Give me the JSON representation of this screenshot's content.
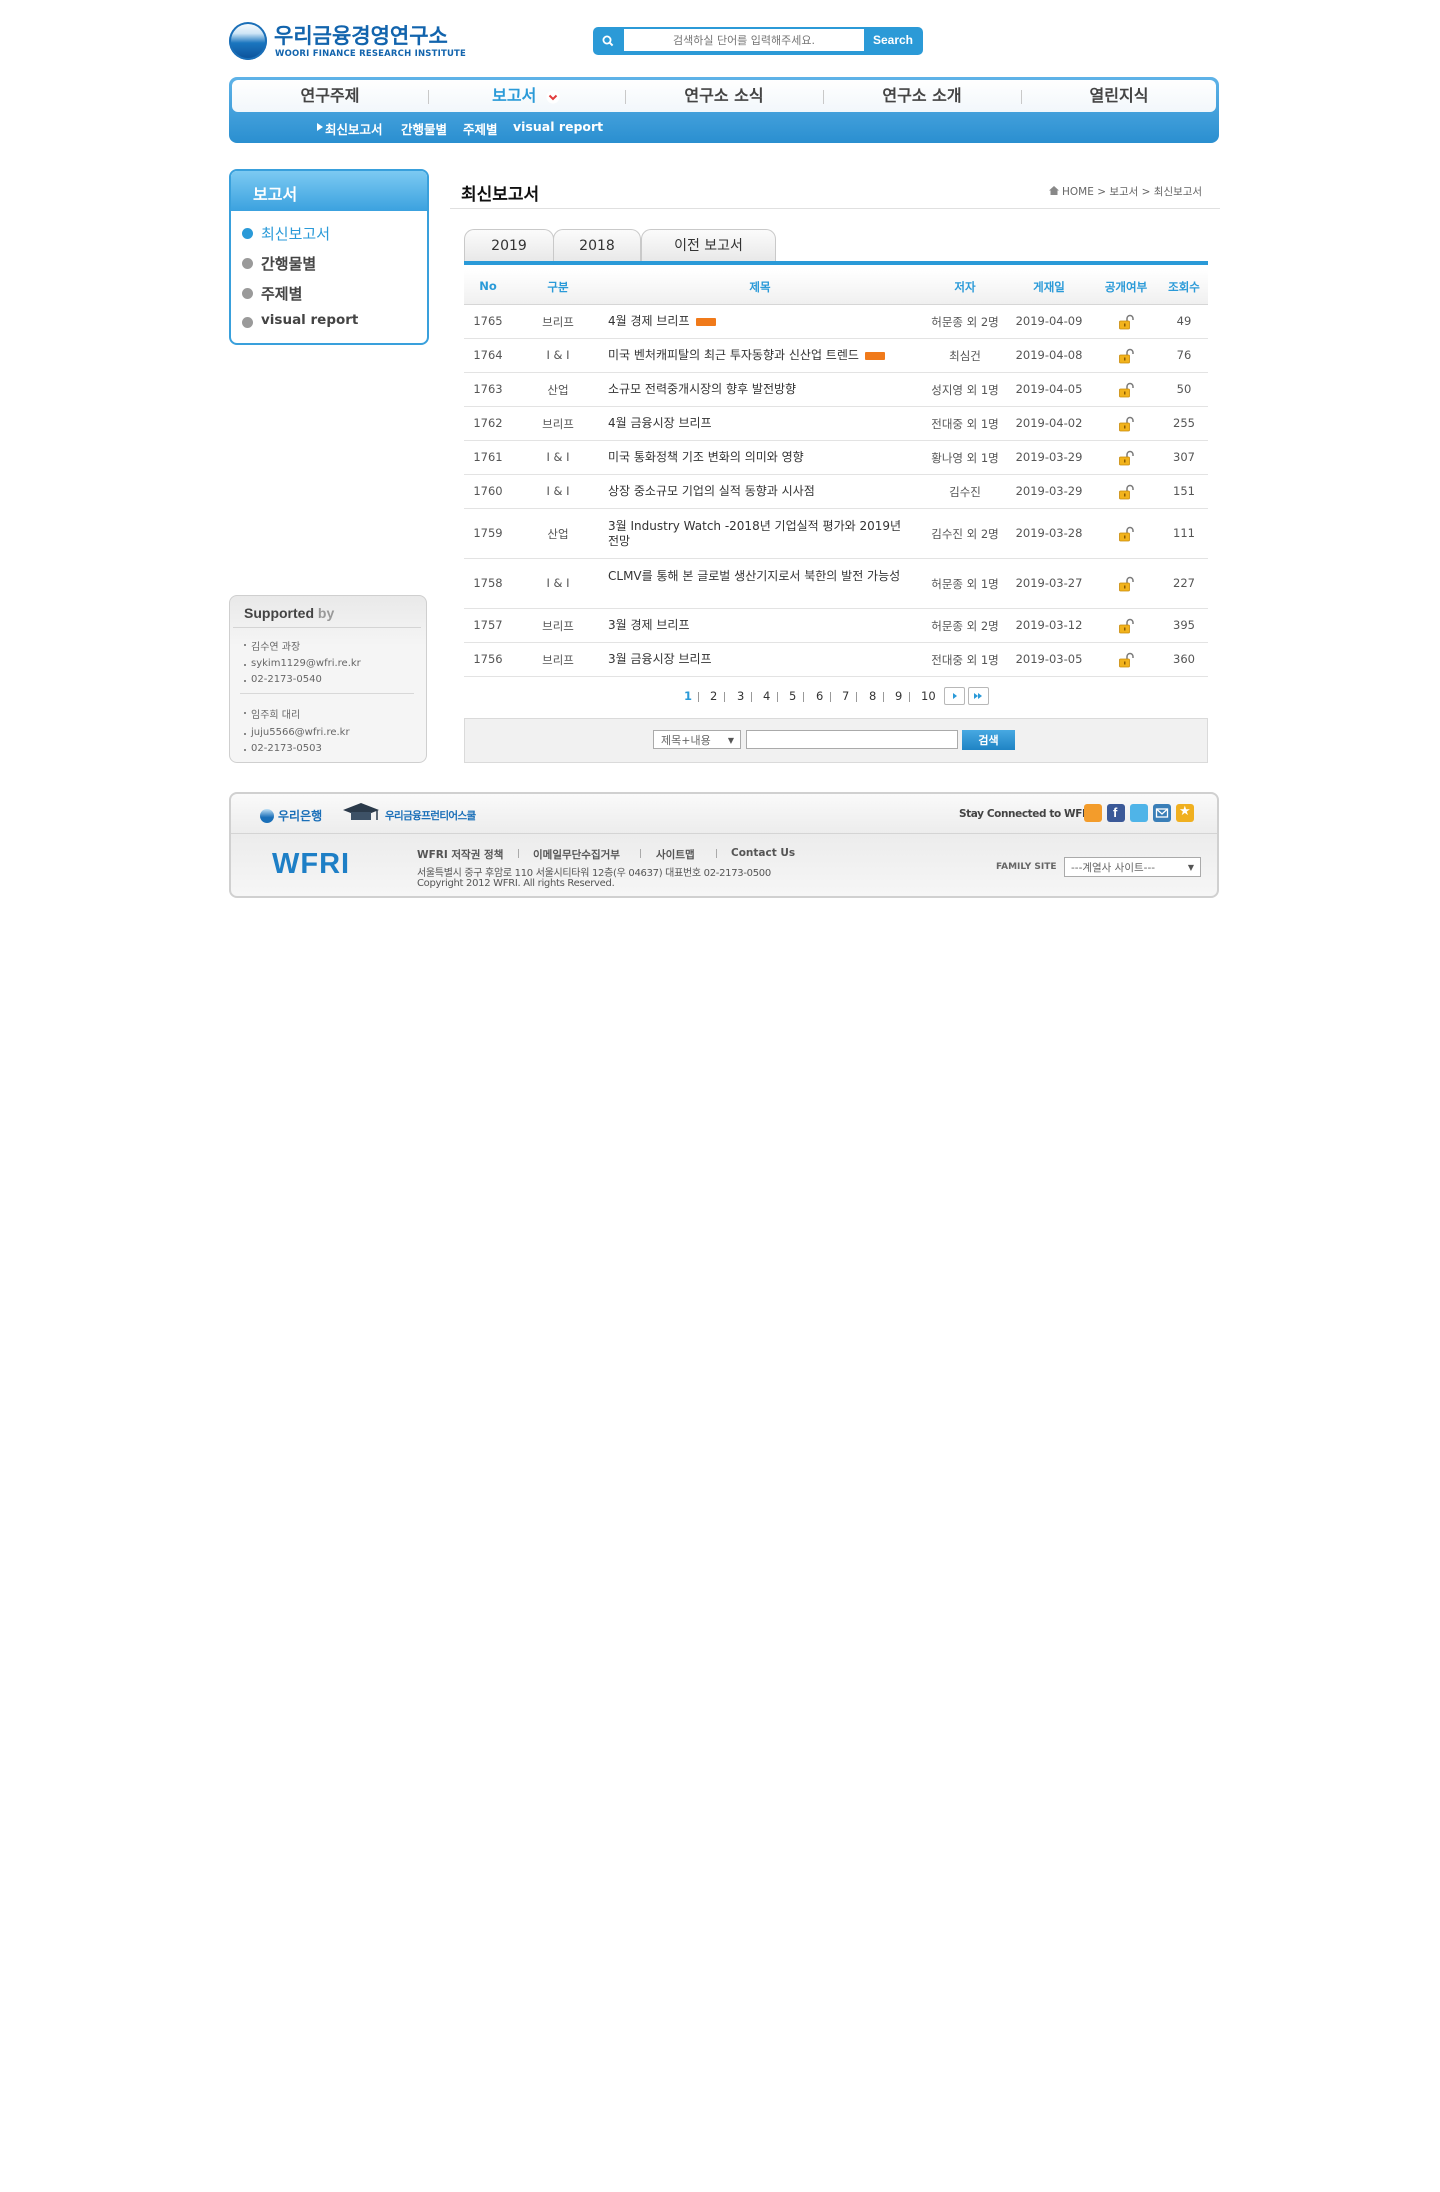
{
  "header": {
    "logo_kr": "우리금융경영연구소",
    "logo_en": "WOORI FINANCE RESEARCH INSTITUTE",
    "search_placeholder": "검색하실 단어를 입력해주세요.",
    "search_button": "Search"
  },
  "gnb": {
    "items": [
      {
        "label": "연구주제"
      },
      {
        "label": "보고서"
      },
      {
        "label": "연구소 소식"
      },
      {
        "label": "연구소 소개"
      },
      {
        "label": "열린지식"
      }
    ],
    "sub_items": [
      "최신보고서",
      "간행물별",
      "주제별",
      "visual report"
    ]
  },
  "lnb": {
    "title": "보고서",
    "items": [
      "최신보고서",
      "간행물별",
      "주제별",
      "visual report"
    ]
  },
  "support": {
    "title": "Supported",
    "title_by": "by",
    "contacts": [
      {
        "name": "김수연 과장",
        "email": "sykim1129@wfri.re.kr",
        "phone": "02-2173-0540"
      },
      {
        "name": "임주희 대리",
        "email": "juju5566@wfri.re.kr",
        "phone": "02-2173-0503"
      }
    ]
  },
  "content": {
    "title": "최신보고서",
    "breadcrumb": "HOME > 보고서 > 최신보고서",
    "tabs": [
      "2019",
      "2018",
      "이전 보고서"
    ],
    "columns": [
      "No",
      "구분",
      "제목",
      "저자",
      "게재일",
      "공개여부",
      "조회수"
    ],
    "rows": [
      {
        "no": "1765",
        "category": "브리프",
        "title": "4월 경제 브리프",
        "new": true,
        "author": "허문종 외 2명",
        "date": "2019-04-09",
        "views": "49"
      },
      {
        "no": "1764",
        "category": "I & I",
        "title": "미국 벤처캐피탈의 최근 투자동향과 신산업 트렌드",
        "new": true,
        "author": "최심건",
        "date": "2019-04-08",
        "views": "76"
      },
      {
        "no": "1763",
        "category": "산업",
        "title": "소규모 전력중개시장의 향후 발전방향",
        "new": false,
        "author": "성지영 외 1명",
        "date": "2019-04-05",
        "views": "50"
      },
      {
        "no": "1762",
        "category": "브리프",
        "title": "4월 금융시장 브리프",
        "new": false,
        "author": "전대중 외 1명",
        "date": "2019-04-02",
        "views": "255"
      },
      {
        "no": "1761",
        "category": "I & I",
        "title": "미국 통화정책 기조 변화의 의미와 영향",
        "new": false,
        "author": "황나영 외 1명",
        "date": "2019-03-29",
        "views": "307"
      },
      {
        "no": "1760",
        "category": "I & I",
        "title": "상장 중소규모 기업의 실적 동향과 시사점",
        "new": false,
        "author": "김수진",
        "date": "2019-03-29",
        "views": "151"
      },
      {
        "no": "1759",
        "category": "산업",
        "title": "3월 Industry Watch -2018년 기업실적 평가와 2019년 전망",
        "new": false,
        "author": "김수진 외 2명",
        "date": "2019-03-28",
        "views": "111"
      },
      {
        "no": "1758",
        "category": "I & I",
        "title": "CLMV를 통해 본 글로벌 생산기지로서 북한의 발전 가능성",
        "new": false,
        "author": "허문종 외 1명",
        "date": "2019-03-27",
        "views": "227"
      },
      {
        "no": "1757",
        "category": "브리프",
        "title": "3월 경제 브리프",
        "new": false,
        "author": "허문종 외 2명",
        "date": "2019-03-12",
        "views": "395"
      },
      {
        "no": "1756",
        "category": "브리프",
        "title": "3월 금융시장 브리프",
        "new": false,
        "author": "전대중 외 1명",
        "date": "2019-03-05",
        "views": "360"
      }
    ],
    "pagination": [
      "1",
      "2",
      "3",
      "4",
      "5",
      "6",
      "7",
      "8",
      "9",
      "10"
    ],
    "current_page": "1",
    "search_select": "제목+내용",
    "search_button": "검색"
  },
  "footer": {
    "woori_bank": "우리은행",
    "woori_fis": "우리금융프런티어스쿨",
    "wfri_logo": "WFRI",
    "links": [
      "WFRI 저작권 정책",
      "이메일무단수집거부",
      "사이트맵",
      "Contact Us"
    ],
    "address": "서울특별시 중구 후암로 110 서울시티타워 12층(우 04637) 대표번호 02-2173-0500",
    "copyright": "Copyright 2012 WFRI. All rights Reserved.",
    "stay_connected": "Stay Connected to WFRI",
    "family_label": "FAMILY SITE",
    "family_select": "---계열사 사이트---"
  },
  "colors": {
    "accent": "#2a9ad8",
    "new_badge": "#f07a1a"
  }
}
